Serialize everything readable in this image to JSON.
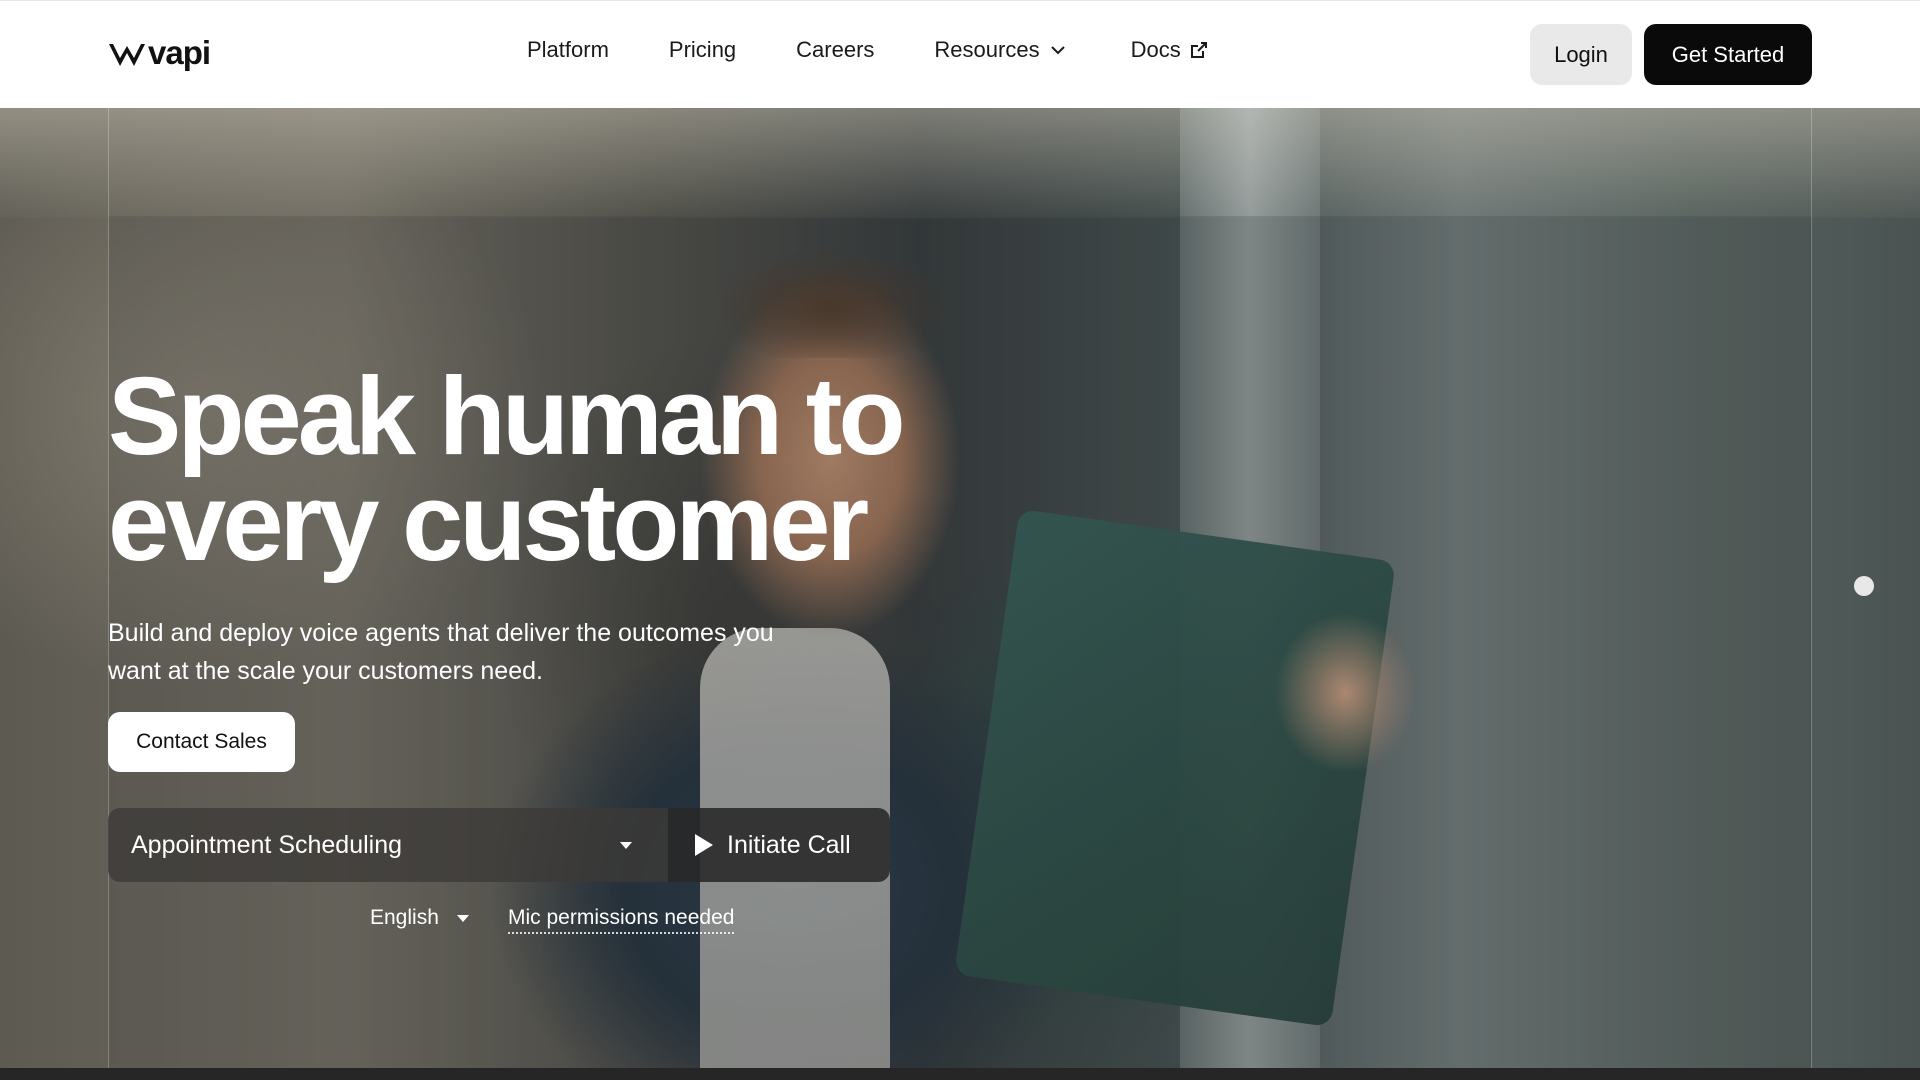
{
  "header": {
    "logo_text": "vapi",
    "nav": {
      "platform": "Platform",
      "pricing": "Pricing",
      "careers": "Careers",
      "resources": "Resources",
      "docs": "Docs"
    },
    "login_label": "Login",
    "get_started_label": "Get Started"
  },
  "hero": {
    "title_line1": "Speak human to",
    "title_line2": "every customer",
    "subtitle_line1": "Build and deploy voice agents that deliver the outcomes you",
    "subtitle_line2": "want at the scale your customers need.",
    "contact_sales_label": "Contact Sales",
    "scenario_selected": "Appointment Scheduling",
    "initiate_call_label": "Initiate Call",
    "language_selected": "English",
    "mic_status": "Mic permissions needed"
  },
  "icons": {
    "resources": "chevron-down-icon",
    "docs": "external-link-icon",
    "scenario": "caret-down-icon",
    "call": "play-icon",
    "language": "caret-down-icon"
  },
  "colors": {
    "primary_button": "#0a0a0a",
    "secondary_button": "#e9e9e9",
    "hero_text": "#ffffff"
  }
}
